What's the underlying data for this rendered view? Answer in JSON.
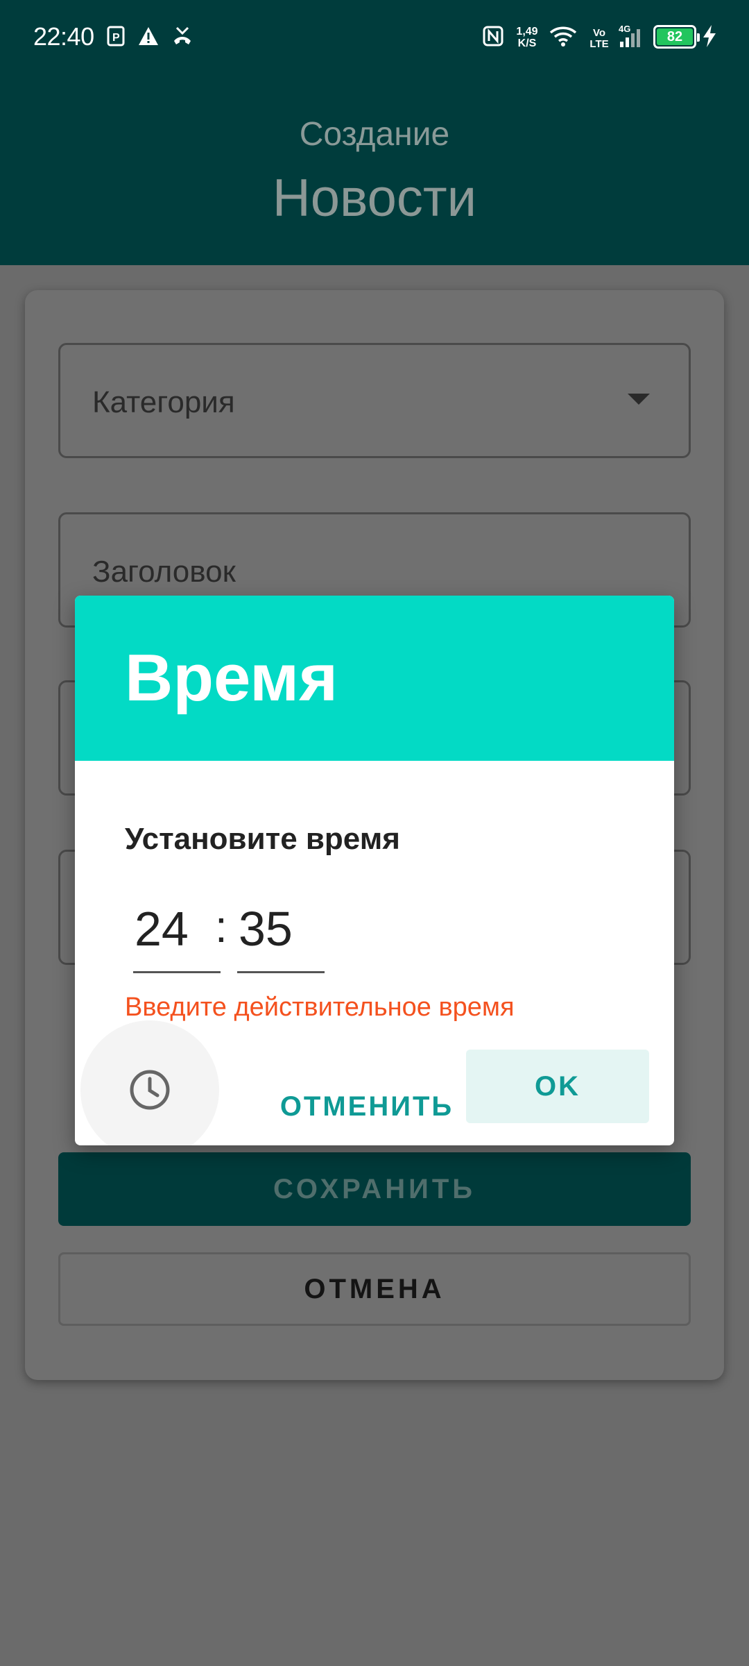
{
  "status_bar": {
    "time": "22:40",
    "net_speed_value": "1,49",
    "net_speed_unit": "K/S",
    "volte_top": "Vo",
    "volte_bottom": "LTE",
    "network_type": "4G",
    "battery_level": "82",
    "icons": [
      "parking-icon",
      "alert-icon",
      "missed-call-icon",
      "nfc-icon",
      "wifi-icon",
      "signal-icon",
      "battery-icon",
      "charging-icon"
    ]
  },
  "header": {
    "subtitle": "Создание",
    "title": "Новости"
  },
  "form": {
    "category_label": "Категория",
    "title_label": "Заголовок",
    "save_label": "СОХРАНИТЬ",
    "cancel_label": "ОТМЕНА"
  },
  "dialog": {
    "title": "Время",
    "subtitle": "Установите время",
    "hour": "24",
    "separator": ":",
    "minute": "35",
    "error": "Введите действительное время",
    "cancel_label": "ОТМЕНИТЬ",
    "ok_label": "OK"
  },
  "colors": {
    "header_bg": "#003c3c",
    "dialog_header_bg": "#03dac5",
    "accent_text": "#0f9a95",
    "error_text": "#f4511e",
    "scrim": "#6b6b6b"
  }
}
